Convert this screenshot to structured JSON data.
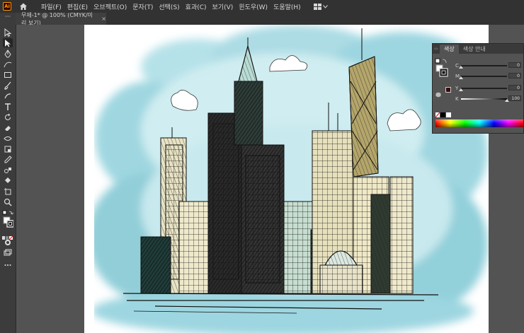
{
  "app": {
    "logo_text": "Ai"
  },
  "menu": [
    "파일(F)",
    "편집(E)",
    "오브젝트(O)",
    "문자(T)",
    "선택(S)",
    "효과(C)",
    "보기(V)",
    "윈도우(W)",
    "도움말(H)"
  ],
  "document": {
    "tab_title": "무제-1* @ 100% (CMYK/미리 보기)",
    "close_symbol": "×"
  },
  "tools": [
    "selection-tool",
    "direct-selection-tool",
    "pen-tool",
    "curvature-tool",
    "rectangle-tool",
    "paintbrush-tool",
    "shaper-tool",
    "type-tool",
    "rotate-tool",
    "eraser-tool",
    "width-tool",
    "free-transform-tool",
    "gradient-tool",
    "eyedropper-tool",
    "blend-tool",
    "live-paint-tool",
    "artboard-tool",
    "zoom-tool"
  ],
  "color_panel": {
    "tabs": [
      "색상",
      "색상 안내"
    ],
    "active_tab": "색상",
    "sliders": [
      {
        "label": "C",
        "value": "0",
        "position": 0.0
      },
      {
        "label": "M",
        "value": "0",
        "position": 0.0
      },
      {
        "label": "Y",
        "value": "0",
        "position": 0.0
      },
      {
        "label": "K",
        "value": "100",
        "position": 1.0
      }
    ],
    "stroke_color": "#1a0a0a",
    "fill_color": "#ffffff"
  },
  "colors": {
    "accent": "#ff9a00",
    "sky": "#8fd0db",
    "ink": "#111111"
  }
}
